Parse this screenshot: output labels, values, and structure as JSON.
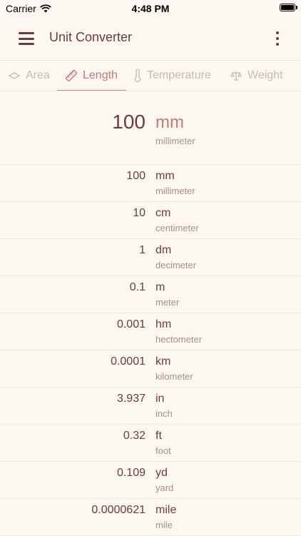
{
  "status": {
    "carrier": "Carrier",
    "time": "4:48 PM"
  },
  "appbar": {
    "title": "Unit Converter"
  },
  "tabs": [
    {
      "label": "Area",
      "icon": "area-icon"
    },
    {
      "label": "Length",
      "icon": "ruler-icon",
      "active": true
    },
    {
      "label": "Temperature",
      "icon": "thermometer-icon"
    },
    {
      "label": "Weight",
      "icon": "scale-icon"
    }
  ],
  "input": {
    "value": "100",
    "unit": "mm",
    "name": "millimeter"
  },
  "conversions": [
    {
      "value": "100",
      "unit": "mm",
      "name": "millimeter"
    },
    {
      "value": "10",
      "unit": "cm",
      "name": "centimeter"
    },
    {
      "value": "1",
      "unit": "dm",
      "name": "decimeter"
    },
    {
      "value": "0.1",
      "unit": "m",
      "name": "meter"
    },
    {
      "value": "0.001",
      "unit": "hm",
      "name": "hectometer"
    },
    {
      "value": "0.0001",
      "unit": "km",
      "name": "kilometer"
    },
    {
      "value": "3.937",
      "unit": "in",
      "name": "inch"
    },
    {
      "value": "0.32",
      "unit": "ft",
      "name": "foot"
    },
    {
      "value": "0.109",
      "unit": "yd",
      "name": "yard"
    },
    {
      "value": "0.0000621",
      "unit": "mile",
      "name": "mile"
    }
  ],
  "colors": {
    "accent": "#c77873",
    "text": "#6d3b3b",
    "muted": "#a88f86",
    "background": "#fdf7f1"
  }
}
